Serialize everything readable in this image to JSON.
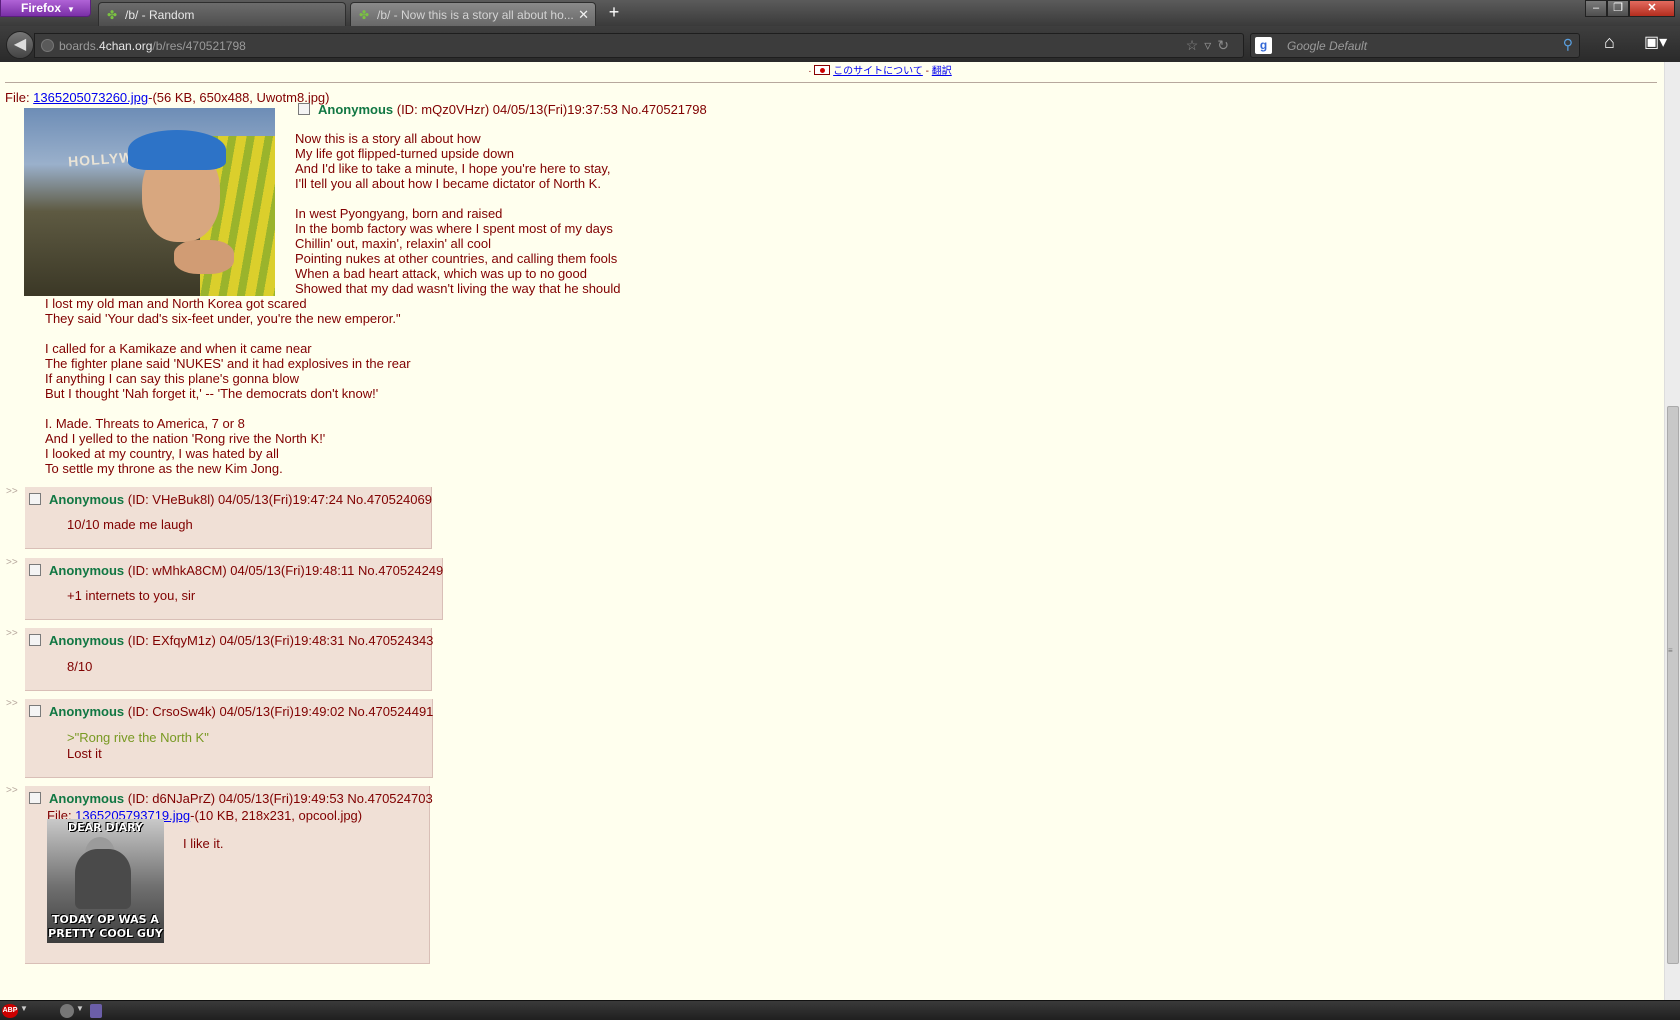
{
  "browser": {
    "menu_button": "Firefox",
    "tabs": [
      {
        "label": "/b/ - Random"
      },
      {
        "label": "/b/ - Now this is a story all about ho..."
      }
    ],
    "url_prefix": "boards.",
    "url_domain": "4chan.org",
    "url_path": "/b/res/470521798",
    "search_placeholder": "Google Default"
  },
  "page": {
    "top_links": {
      "about": "このサイトについて",
      "translate": "翻訳",
      "sep": "-"
    },
    "op": {
      "file_label": "File: ",
      "file_link": "1365205073260.jpg",
      "file_info": "-(56 KB, 650x488, Uwotm8.jpg)",
      "thumb_text": "HOLLYWOOD",
      "name": "Anonymous",
      "meta": " (ID: mQz0VHzr) 04/05/13(Fri)19:37:53 No.470521798",
      "lines": [
        "Now this is a story all about how",
        "My life got flipped-turned upside down",
        "And I'd like to take a minute, I hope you're here to stay,",
        "I'll tell you all about how I became dictator of North K.",
        "",
        "In west Pyongyang, born and raised",
        "In the bomb factory was where I spent most of my days",
        "Chillin' out, maxin', relaxin' all cool",
        "Pointing nukes at other countries, and calling them fools",
        "When a bad heart attack, which was up to no good",
        "Showed that my dad wasn't living the way that he should",
        "I lost my old man and North Korea got scared",
        "They said 'Your dad's six-feet under, you're the new emperor.\"",
        "",
        "I called for a Kamikaze and when it came near",
        "The fighter plane said 'NUKES' and it had explosives in the rear",
        "If anything I can say this plane's gonna blow",
        "But I thought 'Nah forget it,' -- 'The democrats don't know!'",
        "",
        "I. Made. Threats to America, 7 or 8",
        "And I yelled to the nation 'Rong rive the North K!'",
        "I looked at my country, I was hated by all",
        "To settle my throne as the new Kim Jong."
      ]
    },
    "replies": [
      {
        "arrows": ">>",
        "name": "Anonymous",
        "meta": " (ID: VHeBuk8l) 04/05/13(Fri)19:47:24 No.470524069",
        "text": "10/10 made me laugh"
      },
      {
        "arrows": ">>",
        "name": "Anonymous",
        "meta": " (ID: wMhkA8CM) 04/05/13(Fri)19:48:11 No.470524249",
        "text": "+1 internets to you, sir"
      },
      {
        "arrows": ">>",
        "name": "Anonymous",
        "meta": " (ID: EXfqyM1z) 04/05/13(Fri)19:48:31 No.470524343",
        "text": "8/10"
      },
      {
        "arrows": ">>",
        "name": "Anonymous",
        "meta": " (ID: CrsoSw4k) 04/05/13(Fri)19:49:02 No.470524491",
        "greentext": ">\"Rong rive the North K\"",
        "text": "Lost it"
      },
      {
        "arrows": ">>",
        "name": "Anonymous",
        "meta": " (ID: d6NJaPrZ) 04/05/13(Fri)19:49:53 No.470524703",
        "file_label": "File: ",
        "file_link": "1365205793719.jpg",
        "file_info": "-(10 KB, 218x231, opcool.jpg)",
        "thumb_top": "DEAR DIARY",
        "thumb_bottom_1": "TODAY OP WAS A",
        "thumb_bottom_2": "PRETTY COOL GUY",
        "text": "I like it."
      }
    ]
  },
  "status_bar": {
    "abp": "ABP"
  },
  "colors": {
    "page_bg": "#ffffee",
    "post_bg": "#f0e0d6",
    "name": "#117743",
    "text": "#800000",
    "greentext": "#789922"
  }
}
